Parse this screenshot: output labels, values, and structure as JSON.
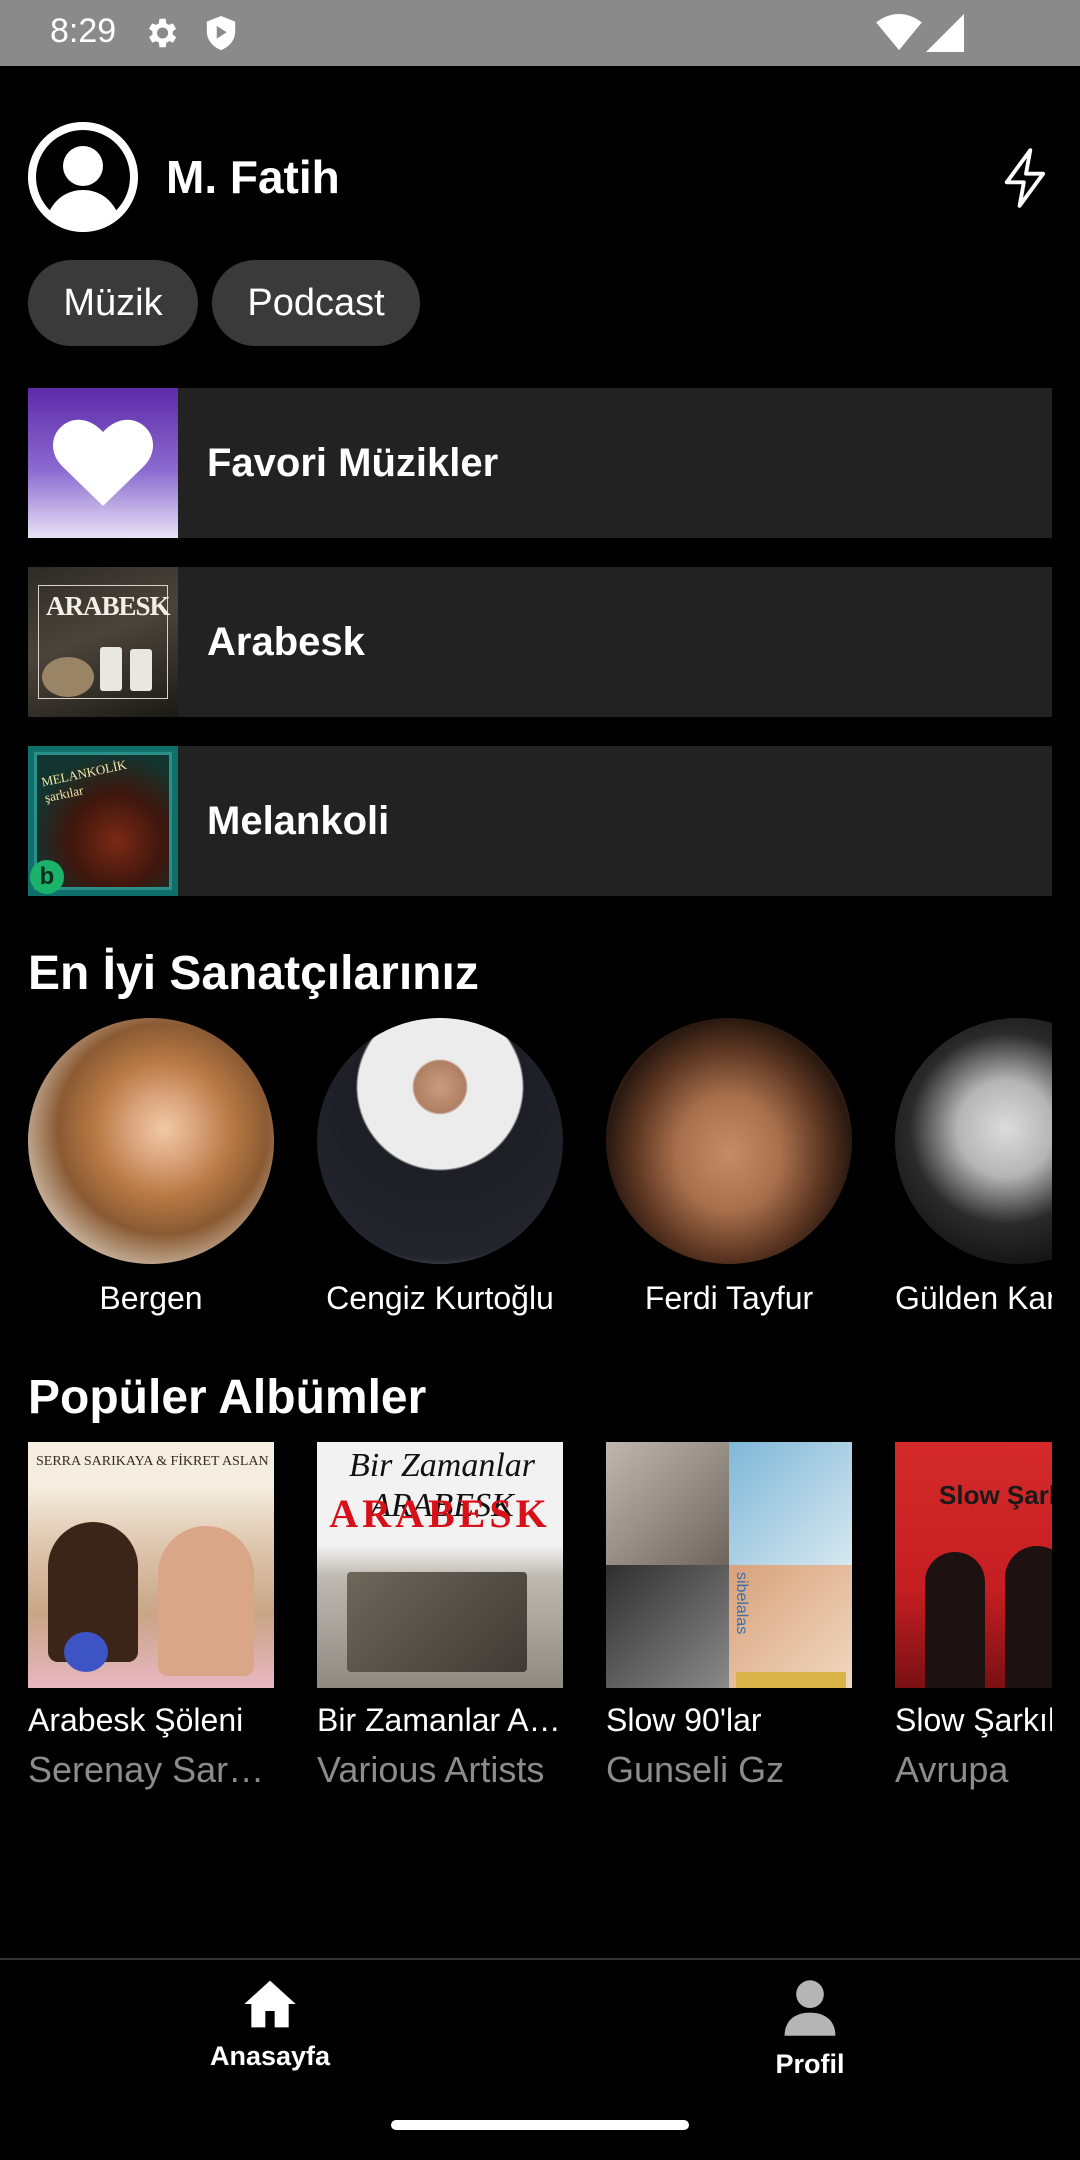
{
  "status_bar": {
    "time": "8:29"
  },
  "header": {
    "username": "M. Fatih"
  },
  "chips": [
    "Müzik",
    "Podcast"
  ],
  "playlists": [
    {
      "label": "Favori Müzikler",
      "thumb_text": ""
    },
    {
      "label": "Arabesk",
      "thumb_text": "ARABESK"
    },
    {
      "label": "Melankoli",
      "thumb_text": "MELANKOLİK şarkılar"
    }
  ],
  "artists_section": {
    "title": "En İyi Sanatçılarınız",
    "items": [
      {
        "name": "Bergen"
      },
      {
        "name": "Cengiz Kurtoğlu"
      },
      {
        "name": "Ferdi Tayfur"
      },
      {
        "name": "Gülden Karaböcek"
      }
    ]
  },
  "albums_section": {
    "title": "Popüler Albümler",
    "items": [
      {
        "title": "Arabesk Şöleni",
        "artist": "Serenay Sarıkaya",
        "cover_text": "SERRA SARIKAYA & FİKRET ASLAN"
      },
      {
        "title": "Bir Zamanlar Arabesk",
        "artist": "Various Artists",
        "cover_text": "Bir Zamanlar ARABESK"
      },
      {
        "title": "Slow 90'lar",
        "artist": "Gunseli Gz",
        "cover_text": "sibelalas"
      },
      {
        "title": "Slow Şarkılar",
        "artist": "Avrupa",
        "cover_text": "Slow Şarkılar"
      }
    ]
  },
  "bottom_nav": {
    "home": "Anasayfa",
    "profile": "Profil"
  },
  "colors": {
    "background": "#000000",
    "row_bg": "#222222",
    "chip_bg": "#3a3a3a",
    "secondary_text": "#8c8c8c"
  }
}
